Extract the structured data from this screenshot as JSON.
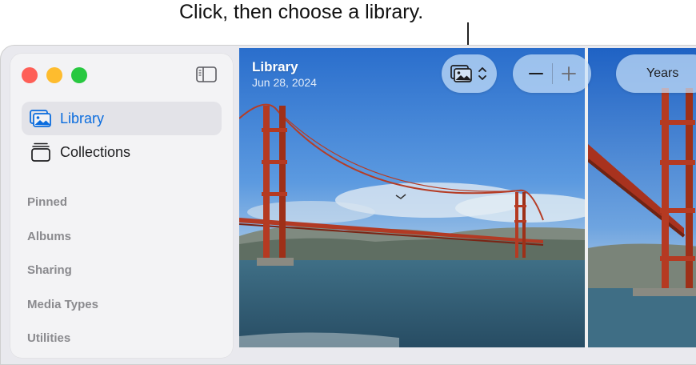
{
  "callout": {
    "text": "Click, then choose a library."
  },
  "sidebar": {
    "items": [
      {
        "label": "Library",
        "icon": "photo-library-icon",
        "selected": true
      },
      {
        "label": "Collections",
        "icon": "collections-stack-icon",
        "selected": false
      }
    ],
    "sections": [
      "Pinned",
      "Albums",
      "Sharing",
      "Media Types",
      "Utilities"
    ]
  },
  "main": {
    "title": "Library",
    "date": "Jun 28, 2024"
  },
  "toolbar": {
    "library_picker_icon": "photo-library-icon",
    "zoom_out_icon": "minus-icon",
    "zoom_in_icon": "plus-icon",
    "years_label": "Years"
  },
  "colors": {
    "accent": "#0a6cde",
    "red": "#fe5f57",
    "yellow": "#febc2e",
    "green": "#28c840"
  }
}
